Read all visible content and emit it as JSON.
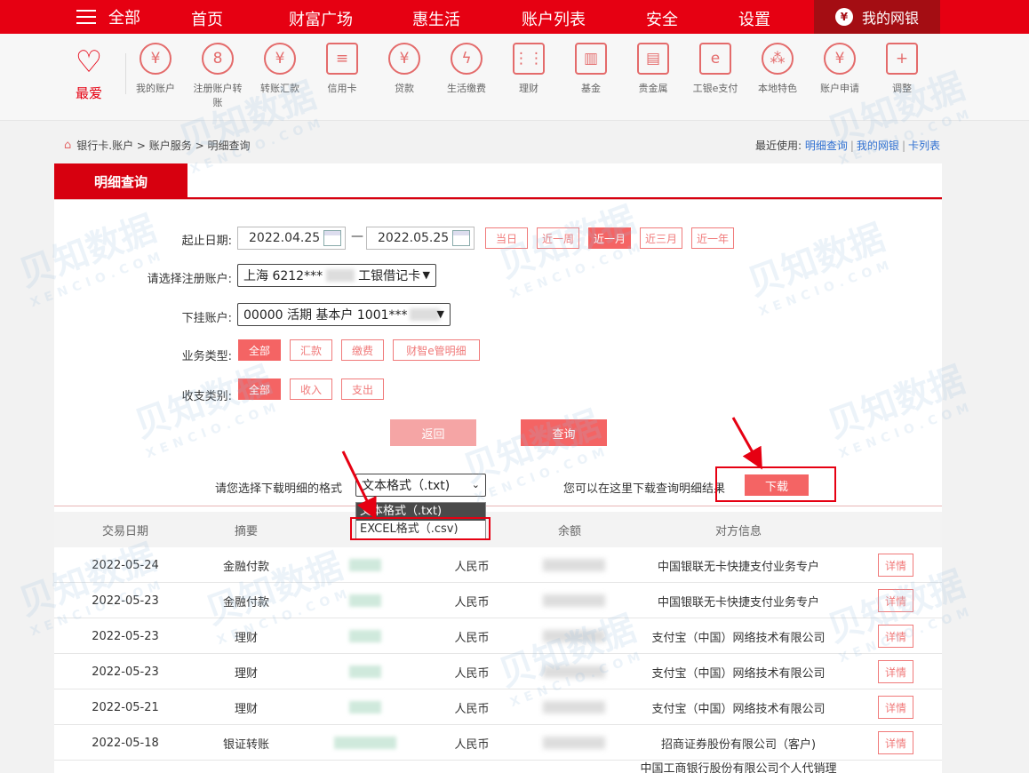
{
  "topnav": {
    "all": "全部",
    "items": [
      "首页",
      "财富广场",
      "惠生活",
      "账户列表",
      "安全",
      "设置"
    ],
    "mybank": "我的网银"
  },
  "iconbar": {
    "fav": "最爱",
    "items": [
      {
        "label": "我的账户",
        "icon": "yen-circle-icon"
      },
      {
        "label": "注册账户转账",
        "icon": "transfer-user-icon"
      },
      {
        "label": "转账汇款",
        "icon": "remit-icon"
      },
      {
        "label": "信用卡",
        "icon": "credit-card-icon"
      },
      {
        "label": "贷款",
        "icon": "loan-bag-icon"
      },
      {
        "label": "生活缴费",
        "icon": "utility-drop-icon"
      },
      {
        "label": "理财",
        "icon": "abacus-icon"
      },
      {
        "label": "基金",
        "icon": "fund-chart-icon"
      },
      {
        "label": "贵金属",
        "icon": "gold-bars-icon"
      },
      {
        "label": "工银e支付",
        "icon": "epay-icon"
      },
      {
        "label": "本地特色",
        "icon": "local-icon"
      },
      {
        "label": "账户申请",
        "icon": "account-apply-icon"
      },
      {
        "label": "调整",
        "icon": "plus-square-icon"
      }
    ]
  },
  "breadcrumb": {
    "path": "银行卡.账户 > 账户服务 > 明细查询"
  },
  "recent": {
    "label": "最近使用:",
    "links": [
      "明细查询",
      "我的网银",
      "卡列表"
    ]
  },
  "tab": {
    "title": "明细查询"
  },
  "form": {
    "date_label": "起止日期:",
    "start_date": "2022.04.25",
    "end_date": "2022.05.25",
    "dash": "—",
    "quick_ranges": [
      "当日",
      "近一周",
      "近一月",
      "近三月",
      "近一年"
    ],
    "active_range": "近一月",
    "account_label": "请选择注册账户:",
    "account_prefix": "上海 6212***",
    "account_suffix": "工银借记卡",
    "sub_label": "下挂账户:",
    "sub_value": "00000 活期 基本户 1001***",
    "biz_label": "业务类型:",
    "biz_types": [
      "全部",
      "汇款",
      "缴费",
      "财智e管明细"
    ],
    "flow_label": "收支类别:",
    "flow_types": [
      "全部",
      "收入",
      "支出"
    ],
    "back_btn": "返回",
    "query_btn": "查询",
    "format_label": "请您选择下载明细的格式",
    "format_selected": "文本格式（.txt)",
    "format_options": [
      "文本格式（.txt)",
      "EXCEL格式（.csv)"
    ],
    "download_hint": "您可以在这里下载查询明细结果",
    "download_btn": "下载"
  },
  "table": {
    "headers": [
      "交易日期",
      "摘要",
      "",
      "",
      "余额",
      "对方信息",
      ""
    ],
    "detail_label": "详情",
    "rows": [
      {
        "date": "2022-05-24",
        "summary": "金融付款",
        "currency": "人民币",
        "party": "中国银联无卡快捷支付业务专户"
      },
      {
        "date": "2022-05-23",
        "summary": "金融付款",
        "currency": "人民币",
        "party": "中国银联无卡快捷支付业务专户"
      },
      {
        "date": "2022-05-23",
        "summary": "理财",
        "currency": "人民币",
        "party": "支付宝（中国）网络技术有限公司"
      },
      {
        "date": "2022-05-23",
        "summary": "理财",
        "currency": "人民币",
        "party": "支付宝（中国）网络技术有限公司"
      },
      {
        "date": "2022-05-21",
        "summary": "理财",
        "currency": "人民币",
        "party": "支付宝（中国）网络技术有限公司"
      },
      {
        "date": "2022-05-18",
        "summary": "银证转账",
        "currency": "人民币",
        "party": "招商证券股份有限公司（客户)"
      },
      {
        "date": "",
        "summary": "",
        "currency": "",
        "party": "中国工商银行股份有限公司个人代销理"
      }
    ]
  },
  "watermark": {
    "text": "贝知数据",
    "sub": "XENCIO.COM"
  },
  "colors": {
    "brand_red": "#e60012",
    "accent_pink": "#f46464",
    "link_blue": "#2e6fd1"
  }
}
